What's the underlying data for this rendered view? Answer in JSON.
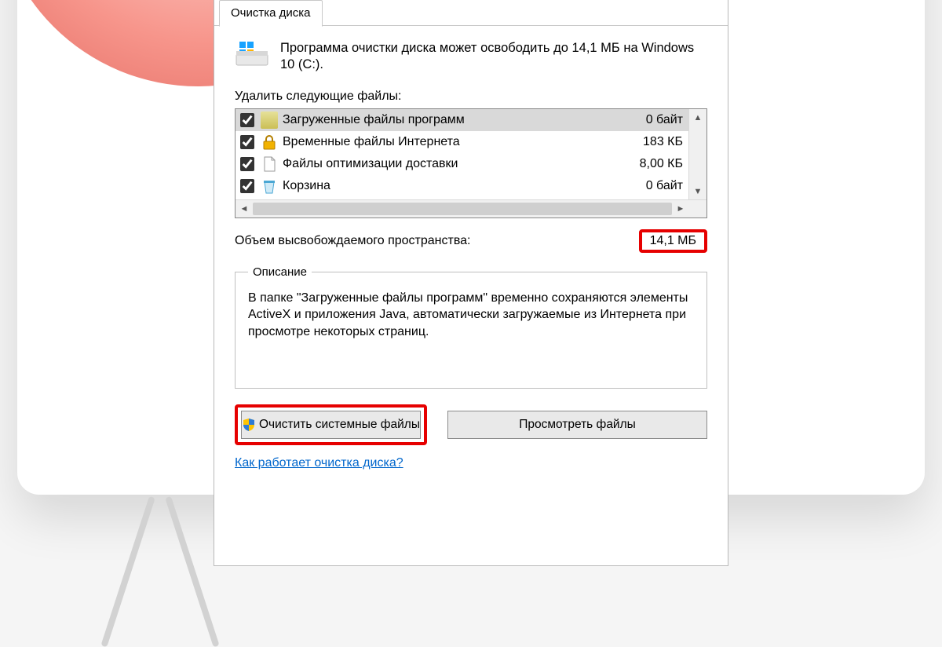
{
  "tab": {
    "label": "Очистка диска"
  },
  "intro": {
    "text": "Программа очистки диска может освободить до 14,1 МБ на Windows 10 (C:)."
  },
  "list": {
    "label": "Удалить следующие файлы:",
    "items": [
      {
        "checked": true,
        "icon": "folder",
        "name": "Загруженные файлы программ",
        "size": "0 байт",
        "selected": true
      },
      {
        "checked": true,
        "icon": "lock",
        "name": "Временные файлы Интернета",
        "size": "183 КБ",
        "selected": false
      },
      {
        "checked": true,
        "icon": "file",
        "name": "Файлы оптимизации доставки",
        "size": "8,00 КБ",
        "selected": false
      },
      {
        "checked": true,
        "icon": "bin",
        "name": "Корзина",
        "size": "0 байт",
        "selected": false
      },
      {
        "checked": false,
        "icon": "file",
        "name": "",
        "size": "",
        "selected": false
      }
    ]
  },
  "total": {
    "label": "Объем высвобождаемого пространства:",
    "value": "14,1 МБ"
  },
  "desc": {
    "legend": "Описание",
    "text": "В папке \"Загруженные файлы программ\" временно сохраняются элементы ActiveX и приложения Java, автоматически загружаемые из Интернета при просмотре некоторых страниц."
  },
  "buttons": {
    "clean_system": "Очистить системные файлы",
    "view_files": "Просмотреть файлы"
  },
  "help_link": "Как работает очистка диска?"
}
